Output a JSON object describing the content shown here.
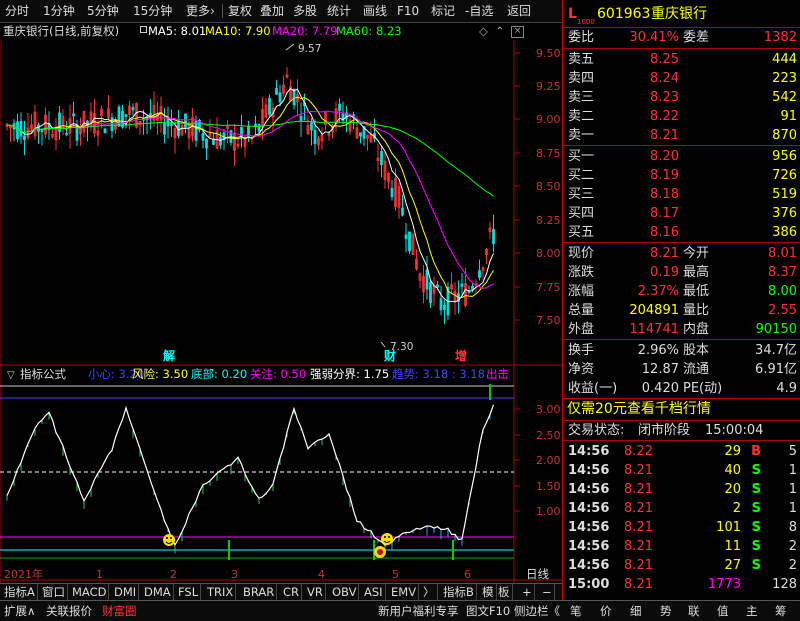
{
  "toolbar": {
    "items": [
      "分时",
      "1分钟",
      "5分钟",
      "15分钟",
      "更多›",
      "复权",
      "叠加",
      "多股",
      "统计",
      "画线",
      "F10",
      "标记",
      "-自选",
      "返回"
    ]
  },
  "titlebar": {
    "stock": "重庆银行(日线,前复权)",
    "ma5": "MA5: 8.01",
    "ma10": "MA10: 7.90",
    "ma20": "MA20: 7.79",
    "ma60": "MA60: 8.23",
    "colors": {
      "ma5": "#ffffff",
      "ma10": "#ffff00",
      "ma20": "#ff00ff",
      "ma60": "#00ff00"
    }
  },
  "price_chart": {
    "y_ticks": [
      "9.50",
      "9.25",
      "9.00",
      "8.75",
      "8.50",
      "8.25",
      "8.00",
      "7.75",
      "7.50"
    ],
    "high_label": "9.57",
    "low_label": "7.30",
    "markers": [
      {
        "text": "解",
        "color": "#00ffff"
      },
      {
        "text": "财",
        "color": "#00ffff"
      },
      {
        "text": "增",
        "color": "#ff3333"
      }
    ]
  },
  "indicator": {
    "name": "指标公式",
    "xiaoxin": "小心: 3.20",
    "fengxian": "风险: 3.50",
    "dibu": "底部: 0.20",
    "guanzhu": "关注: 0.50",
    "qiangruo": "强弱分界: 1.75",
    "qushi": "趋势: 3.18 : 3.18",
    "chuji": "出击",
    "y_ticks": [
      "3.00",
      "2.50",
      "2.00",
      "1.50",
      "1.00"
    ]
  },
  "x_axis": {
    "labels": [
      "2021年",
      "1",
      "2",
      "3",
      "4",
      "5",
      "6"
    ],
    "right_label": "日线"
  },
  "indicator_tabs": [
    "指标A",
    "窗口",
    "MACD",
    "DMI",
    "DMA",
    "FSL",
    "TRIX",
    "BRAR",
    "CR",
    "VR",
    "OBV",
    "ASI",
    "EMV",
    "〉",
    "指标B",
    "模",
    "板",
    "+",
    "−"
  ],
  "status_bar": {
    "left": [
      "扩展∧",
      "关联报价",
      "财富圈"
    ],
    "right": [
      "新用户福利专享",
      "图文F10",
      "侧边栏《"
    ],
    "icons": [
      "笔",
      "价",
      "细",
      "势",
      "联",
      "值",
      "主",
      "筹"
    ]
  },
  "panel": {
    "code": "601963",
    "name": "重庆银行",
    "weibi": {
      "label": "委比",
      "value": "30.41%",
      "label2": "委差",
      "value2": "1382"
    },
    "asks": [
      {
        "label": "卖五",
        "price": "8.25",
        "vol": "444"
      },
      {
        "label": "卖四",
        "price": "8.24",
        "vol": "223"
      },
      {
        "label": "卖三",
        "price": "8.23",
        "vol": "542"
      },
      {
        "label": "卖二",
        "price": "8.22",
        "vol": "91"
      },
      {
        "label": "卖一",
        "price": "8.21",
        "vol": "870"
      }
    ],
    "bids": [
      {
        "label": "买一",
        "price": "8.20",
        "vol": "956"
      },
      {
        "label": "买二",
        "price": "8.19",
        "vol": "726"
      },
      {
        "label": "买三",
        "price": "8.18",
        "vol": "519"
      },
      {
        "label": "买四",
        "price": "8.17",
        "vol": "376"
      },
      {
        "label": "买五",
        "price": "8.16",
        "vol": "386"
      }
    ],
    "stats": [
      {
        "l1": "现价",
        "v1": "8.21",
        "c1": "#ff3333",
        "l2": "今开",
        "v2": "8.01",
        "c2": "#ff3333"
      },
      {
        "l1": "涨跌",
        "v1": "0.19",
        "c1": "#ff3333",
        "l2": "最高",
        "v2": "8.37",
        "c2": "#ff3333"
      },
      {
        "l1": "涨幅",
        "v1": "2.37%",
        "c1": "#ff3333",
        "l2": "最低",
        "v2": "8.00",
        "c2": "#00ff00"
      },
      {
        "l1": "总量",
        "v1": "204891",
        "c1": "#ffff00",
        "l2": "量比",
        "v2": "2.55",
        "c2": "#ff3333"
      },
      {
        "l1": "外盘",
        "v1": "114741",
        "c1": "#ff3333",
        "l2": "内盘",
        "v2": "90150",
        "c2": "#00ff00"
      }
    ],
    "stats2": [
      {
        "l1": "换手",
        "v1": "2.96%",
        "l2": "股本",
        "v2": "34.7亿"
      },
      {
        "l1": "净资",
        "v1": "12.87",
        "l2": "流通",
        "v2": "6.91亿"
      },
      {
        "l1": "收益(一)",
        "v1": "0.420",
        "l2": "PE(动)",
        "v2": "4.9"
      }
    ],
    "promo": "仅需20元查看千档行情",
    "trade_state_label": "交易状态:",
    "trade_state": "闭市阶段",
    "trade_time": "15:00:04",
    "ticks": [
      {
        "t": "14:56",
        "p": "8.22",
        "v": "29",
        "d": "B",
        "n": "5"
      },
      {
        "t": "14:56",
        "p": "8.21",
        "v": "40",
        "d": "S",
        "n": "1"
      },
      {
        "t": "14:56",
        "p": "8.21",
        "v": "20",
        "d": "S",
        "n": "1"
      },
      {
        "t": "14:56",
        "p": "8.21",
        "v": "2",
        "d": "S",
        "n": "1"
      },
      {
        "t": "14:56",
        "p": "8.21",
        "v": "101",
        "d": "S",
        "n": "8"
      },
      {
        "t": "14:56",
        "p": "8.21",
        "v": "11",
        "d": "S",
        "n": "2"
      },
      {
        "t": "14:56",
        "p": "8.21",
        "v": "27",
        "d": "S",
        "n": "2"
      },
      {
        "t": "15:00",
        "p": "8.21",
        "v": "1773",
        "d": "",
        "n": "128"
      }
    ]
  }
}
